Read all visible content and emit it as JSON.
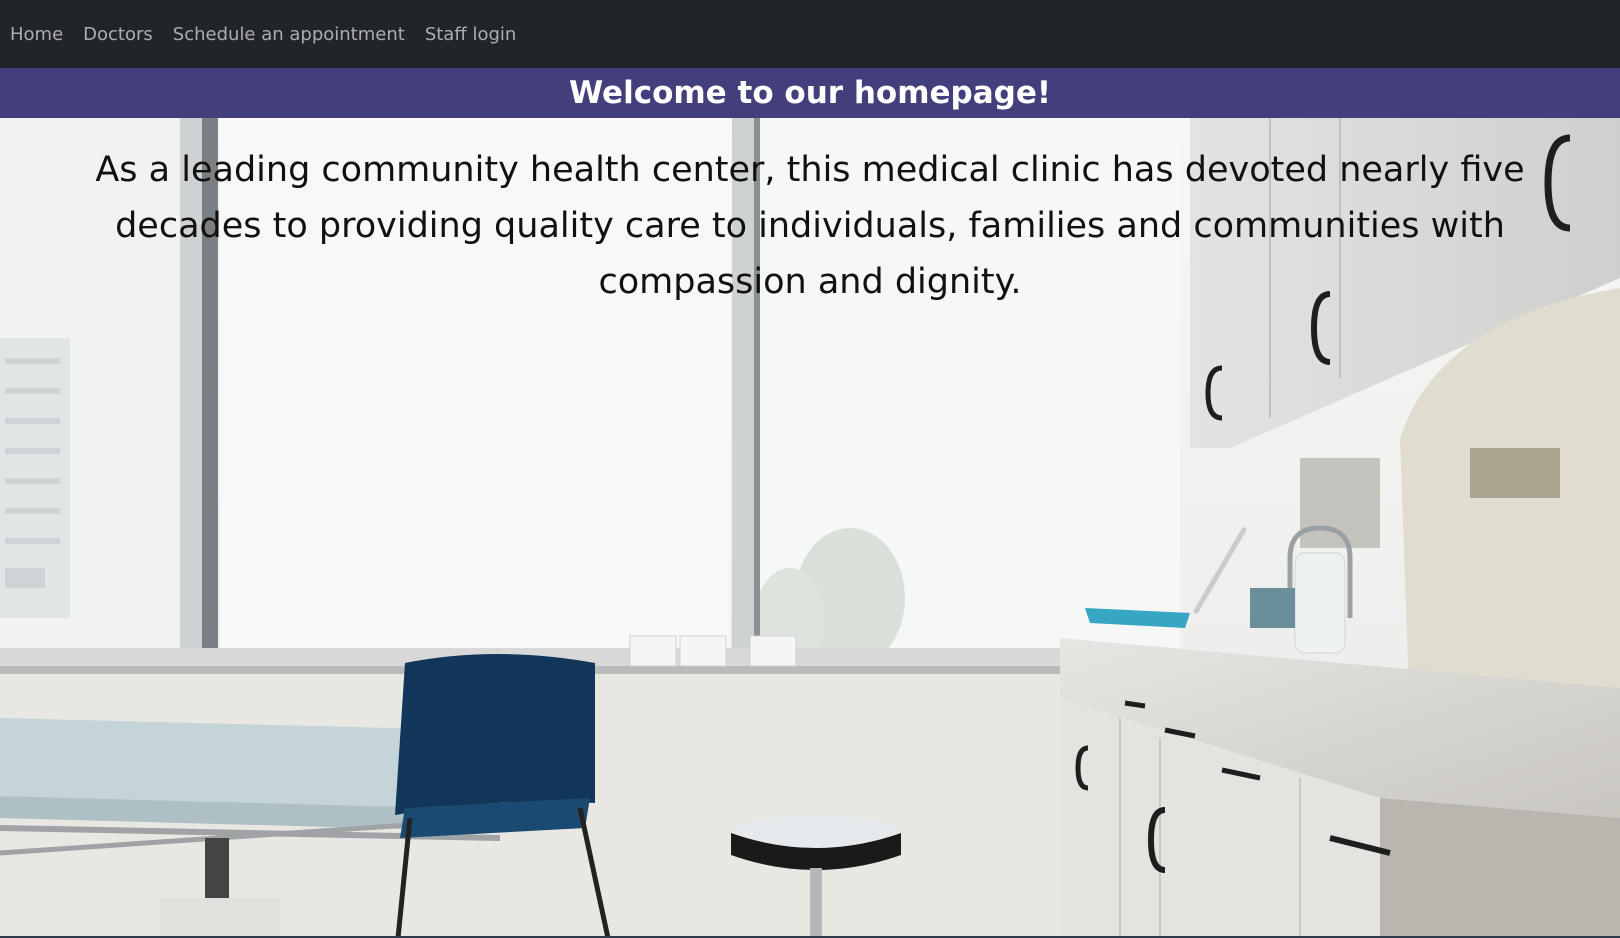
{
  "nav": {
    "links": [
      {
        "label": "Home"
      },
      {
        "label": "Doctors"
      },
      {
        "label": "Schedule an appointment"
      },
      {
        "label": "Staff login"
      }
    ]
  },
  "banner": {
    "title": "Welcome to our homepage!",
    "background_color": "#433f7c"
  },
  "intro": {
    "text": "As a leading community health center, this medical clinic has devoted nearly five decades to providing quality care to individuals, families and communities with compassion and dignity."
  },
  "hero_image": {
    "subject": "clinic-exam-room-photo"
  },
  "colors": {
    "navbar_bg": "#212529",
    "nav_text": "#a6a8aa"
  }
}
